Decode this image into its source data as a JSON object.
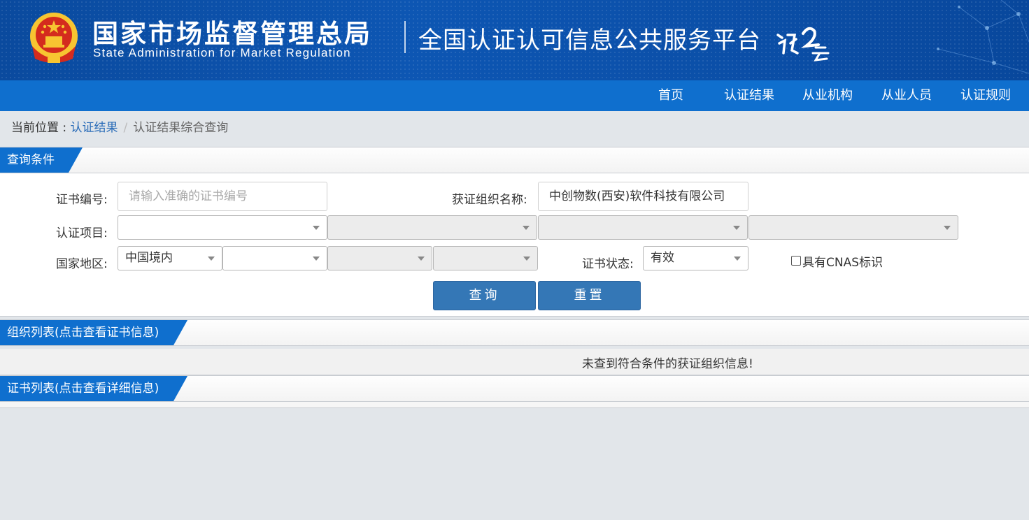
{
  "header": {
    "org_cn": "国家市场监督管理总局",
    "org_en": "State Administration  for  Market Regulation",
    "platform": "全国认证认可信息公共服务平台",
    "colors": {
      "banner": "#0b4fa8",
      "nav": "#0f6fce",
      "emblem_red": "#d42b1e",
      "emblem_gold": "#f7c531"
    }
  },
  "nav": {
    "items": [
      {
        "label": "首页"
      },
      {
        "label": "认证结果"
      },
      {
        "label": "从业机构"
      },
      {
        "label": "从业人员"
      },
      {
        "label": "认证规则"
      }
    ]
  },
  "breadcrumb": {
    "prefix": "当前位置 : ",
    "link": "认证结果",
    "separator": "/",
    "current": "认证结果综合查询"
  },
  "query": {
    "title": "查询条件",
    "cert_no_label": "证书编号:",
    "cert_no_placeholder": "请输入准确的证书编号",
    "org_name_label": "获证组织名称:",
    "org_name_value": "中创物数(西安)软件科技有限公司",
    "project_label": "认证项目:",
    "region_label": "国家地区:",
    "region_value": "中国境内",
    "status_label": "证书状态:",
    "status_value": "有效",
    "cnas_label": "具有CNAS标识",
    "cnas_checked": false,
    "search_button": "查询",
    "reset_button": "重置"
  },
  "org_list": {
    "title": "组织列表(点击查看证书信息)",
    "empty_message": "未查到符合条件的获证组织信息!"
  },
  "cert_list": {
    "title": "证书列表(点击查看详细信息)"
  }
}
